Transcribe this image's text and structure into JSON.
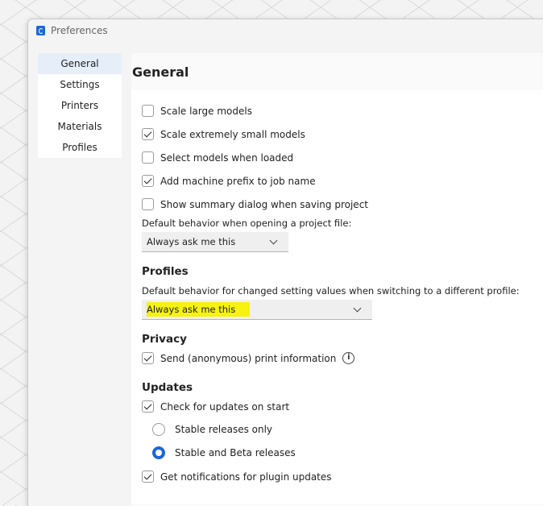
{
  "window": {
    "title": "Preferences"
  },
  "sidebar": {
    "items": [
      {
        "label": "General"
      },
      {
        "label": "Settings"
      },
      {
        "label": "Printers"
      },
      {
        "label": "Materials"
      },
      {
        "label": "Profiles"
      }
    ]
  },
  "main": {
    "title": "General",
    "general": {
      "scale_large_models": {
        "label": "Scale large models",
        "checked": false
      },
      "scale_small_models": {
        "label": "Scale extremely small models",
        "checked": true
      },
      "select_models_loaded": {
        "label": "Select models when loaded",
        "checked": false
      },
      "machine_prefix": {
        "label": "Add machine prefix to job name",
        "checked": true
      },
      "summary_dialog": {
        "label": "Show summary dialog when saving project",
        "checked": false
      },
      "project_file_behavior_label": "Default behavior when opening a project file:",
      "project_file_behavior_value": "Always ask me this"
    },
    "profiles": {
      "heading": "Profiles",
      "behavior_label": "Default behavior for changed setting values when switching to a different profile:",
      "behavior_value": "Always ask me this",
      "highlight_color": "#f7f20f"
    },
    "privacy": {
      "heading": "Privacy",
      "send_print_info": {
        "label": "Send (anonymous) print information",
        "checked": true
      },
      "info_icon": "info-icon"
    },
    "updates": {
      "heading": "Updates",
      "check_on_start": {
        "label": "Check for updates on start",
        "checked": true
      },
      "stable_only": {
        "label": "Stable releases only",
        "selected": false
      },
      "stable_beta": {
        "label": "Stable and Beta releases",
        "selected": true
      },
      "plugin_notifications": {
        "label": "Get notifications for plugin updates",
        "checked": true
      }
    }
  },
  "colors": {
    "accent": "#1c67d8",
    "sidebar_active": "#e6eef9"
  }
}
